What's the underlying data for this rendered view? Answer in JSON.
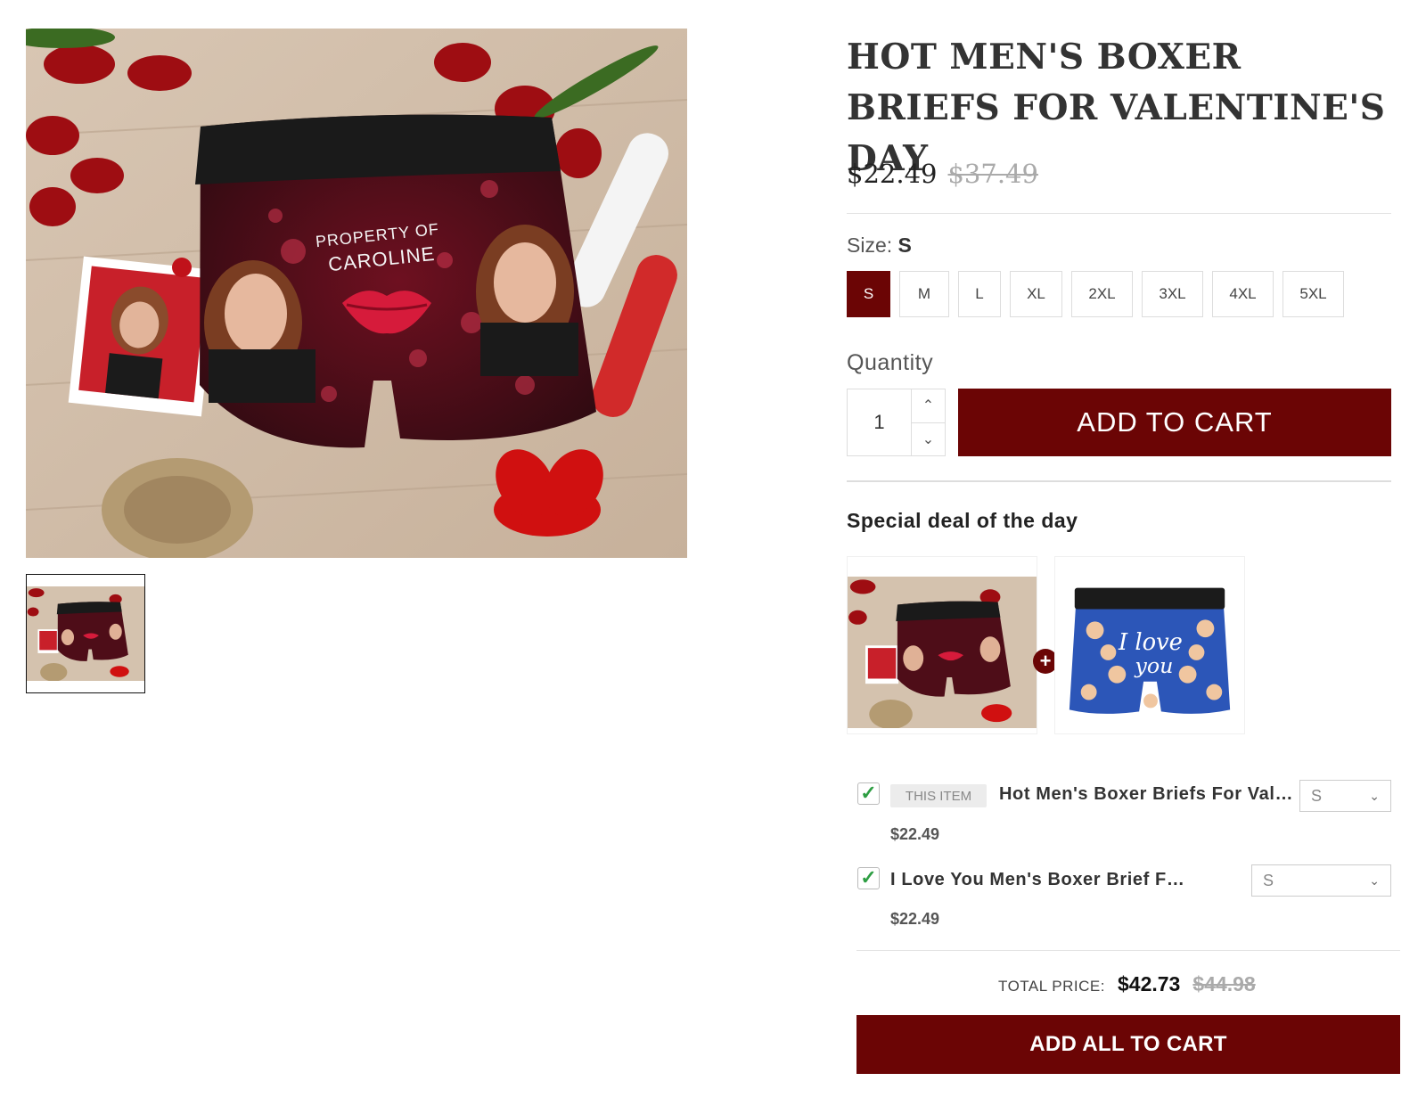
{
  "product": {
    "title": "HOT MEN'S BOXER BRIEFS FOR VALENTINE'S DAY",
    "price": "$22.49",
    "compare_price": "$37.49",
    "image_text_line1": "PROPERTY OF",
    "image_text_line2": "CAROLINE"
  },
  "size": {
    "label": "Size:",
    "selected": "S",
    "options": [
      "S",
      "M",
      "L",
      "XL",
      "2XL",
      "3XL",
      "4XL",
      "5XL"
    ]
  },
  "quantity": {
    "label": "Quantity",
    "value": "1",
    "up_icon": "chevron-up-icon",
    "down_icon": "chevron-down-icon"
  },
  "add_to_cart_label": "ADD TO CART",
  "deal": {
    "title": "Special deal of the day",
    "plus": "+",
    "second_image_text_line1": "I love",
    "second_image_text_line2": "you",
    "items": [
      {
        "checked": true,
        "badge": "THIS ITEM",
        "name": "Hot Men's Boxer Briefs For Vale…",
        "price": "$22.49",
        "size": "S"
      },
      {
        "checked": true,
        "name": "I Love You Men's Boxer Brief Fo…",
        "price": "$22.49",
        "size": "S"
      }
    ],
    "total_label": "TOTAL PRICE:",
    "total_price": "$42.73",
    "total_compare_price": "$44.98",
    "add_all_label": "ADD ALL TO CART"
  },
  "colors": {
    "accent": "#6b0505",
    "check": "#2e9e43",
    "strike": "#aaaaaa"
  }
}
